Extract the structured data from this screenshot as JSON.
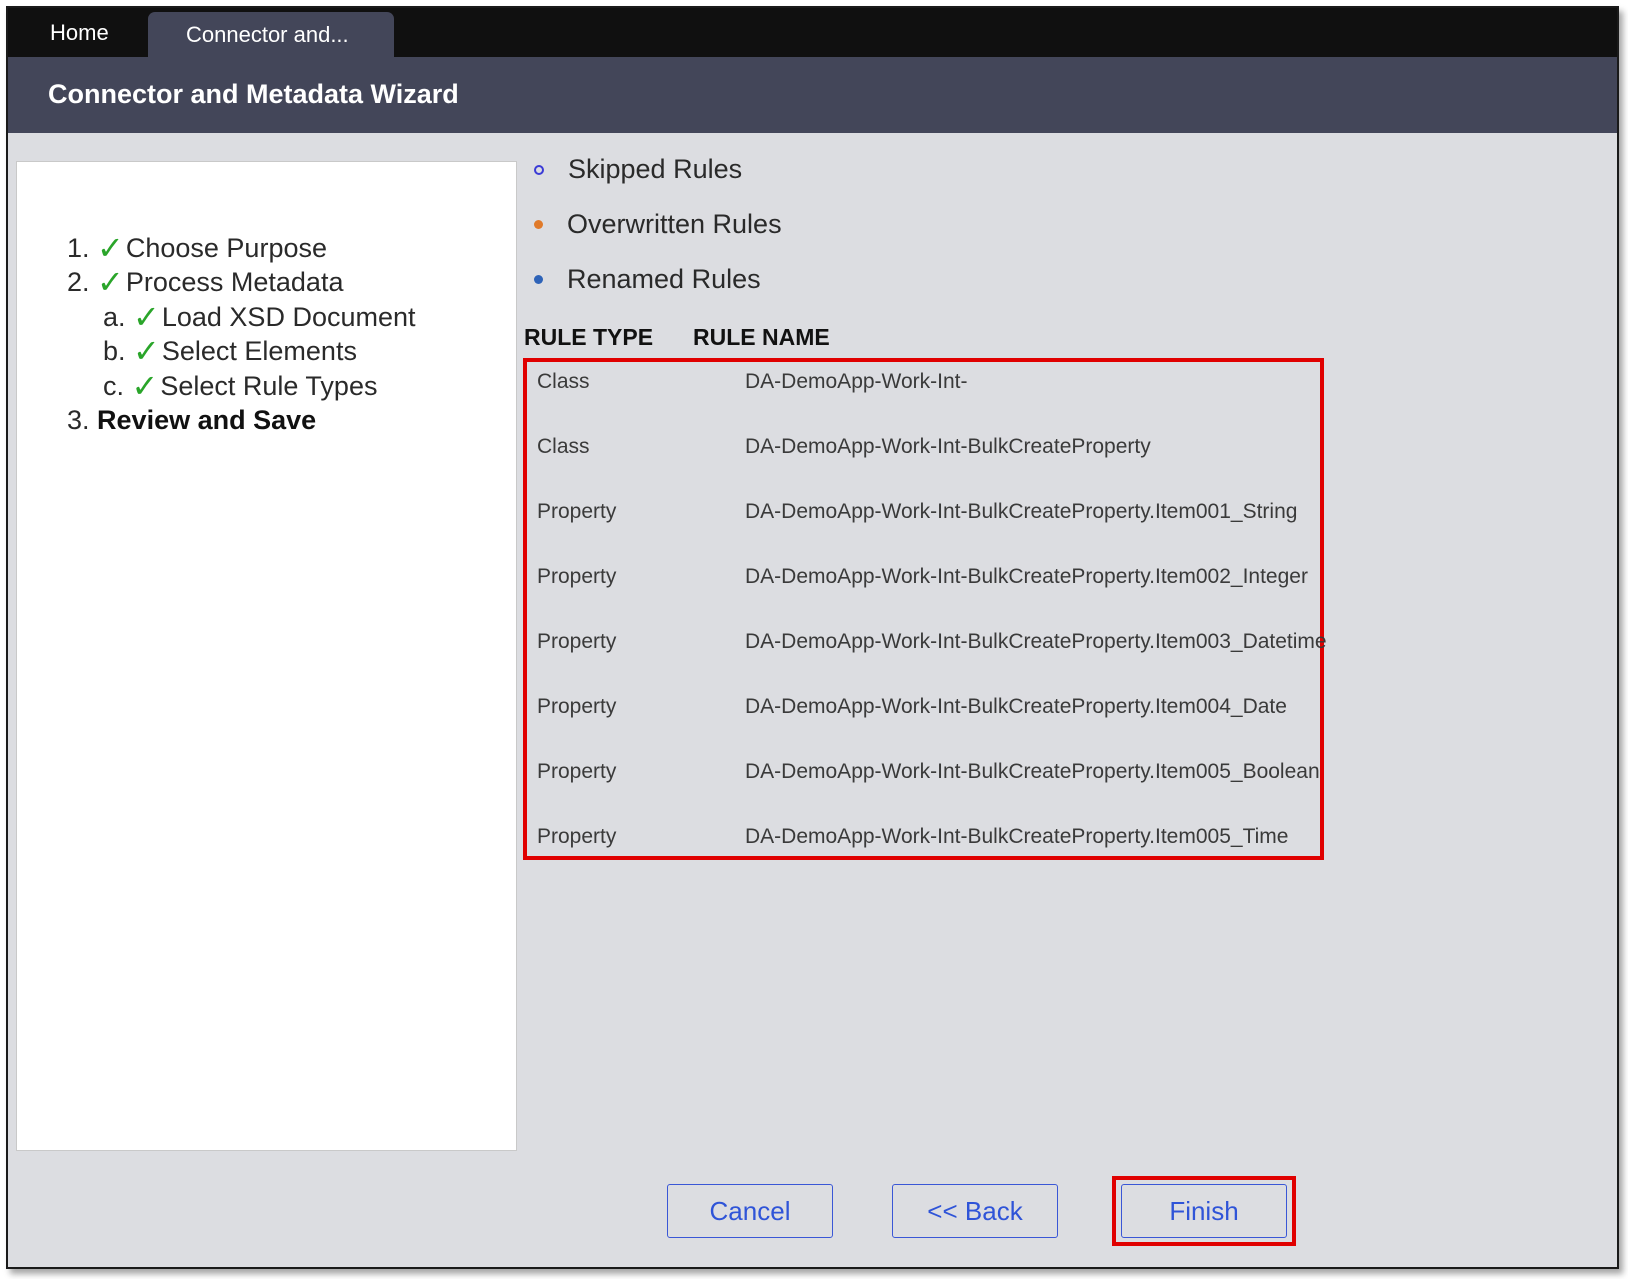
{
  "tabs": [
    {
      "label": "Home"
    },
    {
      "label": "Connector and..."
    }
  ],
  "header": {
    "title": "Connector and Metadata Wizard"
  },
  "steps": [
    {
      "num": "1.",
      "label": "Choose Purpose",
      "done": true
    },
    {
      "num": "2.",
      "label": "Process Metadata",
      "done": true
    },
    {
      "num": "a.",
      "label": "Load XSD Document",
      "done": true
    },
    {
      "num": "b.",
      "label": "Select Elements",
      "done": true
    },
    {
      "num": "c.",
      "label": "Select Rule Types",
      "done": true
    },
    {
      "num": "3.",
      "label": "Review and Save",
      "done": false
    }
  ],
  "check_glyph": "✓",
  "legend": [
    {
      "label": "Skipped Rules",
      "color": "#3b3bd6"
    },
    {
      "label": "Overwritten Rules",
      "color": "#e07a2a"
    },
    {
      "label": "Renamed Rules",
      "color": "#2e63b8"
    }
  ],
  "table": {
    "headers": {
      "type": "RULE TYPE",
      "name": "RULE NAME"
    },
    "rows": [
      {
        "type": "Class",
        "name": "DA-DemoApp-Work-Int-"
      },
      {
        "type": "Class",
        "name": "DA-DemoApp-Work-Int-BulkCreateProperty"
      },
      {
        "type": "Property",
        "name": "DA-DemoApp-Work-Int-BulkCreateProperty.Item001_String"
      },
      {
        "type": "Property",
        "name": "DA-DemoApp-Work-Int-BulkCreateProperty.Item002_Integer"
      },
      {
        "type": "Property",
        "name": "DA-DemoApp-Work-Int-BulkCreateProperty.Item003_Datetime"
      },
      {
        "type": "Property",
        "name": "DA-DemoApp-Work-Int-BulkCreateProperty.Item004_Date"
      },
      {
        "type": "Property",
        "name": "DA-DemoApp-Work-Int-BulkCreateProperty.Item005_Boolean"
      },
      {
        "type": "Property",
        "name": "DA-DemoApp-Work-Int-BulkCreateProperty.Item005_Time"
      }
    ]
  },
  "buttons": {
    "cancel": "Cancel",
    "back": "<< Back",
    "finish": "Finish"
  },
  "colors": {
    "accent": "#2f54d8",
    "header_bg": "#434659",
    "highlight": "#e00000",
    "check": "#2aa52a"
  }
}
